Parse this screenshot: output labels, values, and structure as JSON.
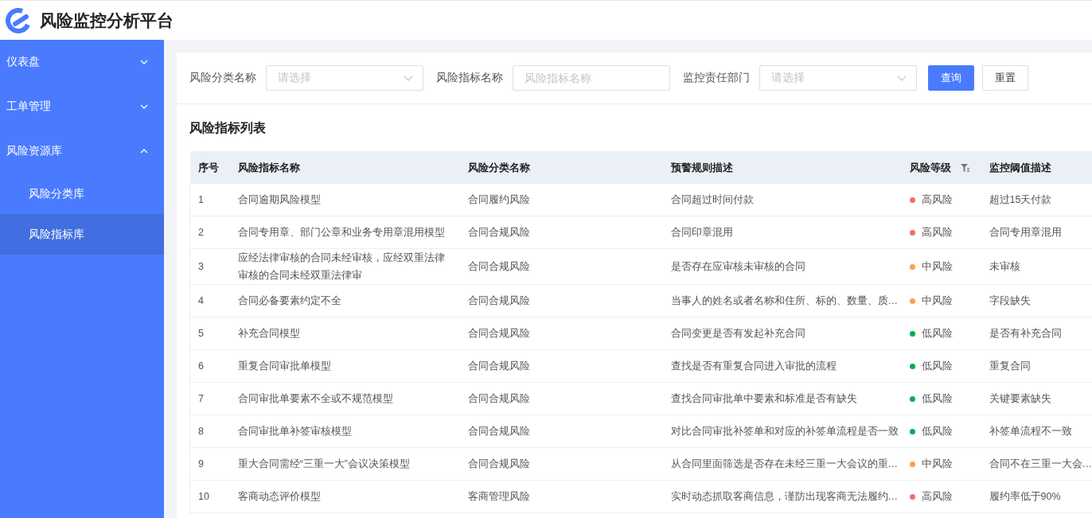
{
  "app": {
    "title": "风险监控分析平台"
  },
  "sidebar": {
    "items": [
      {
        "label": "仪表盘",
        "expanded": false
      },
      {
        "label": "工单管理",
        "expanded": false
      },
      {
        "label": "风险资源库",
        "expanded": true,
        "children": [
          {
            "label": "风险分类库",
            "selected": false
          },
          {
            "label": "风险指标库",
            "selected": true
          }
        ]
      }
    ]
  },
  "filters": [
    {
      "kind": "select",
      "label": "风险分类名称",
      "placeholder": "请选择"
    },
    {
      "kind": "input",
      "label": "风险指标名称",
      "placeholder": "风险指标名称"
    },
    {
      "kind": "select",
      "label": "监控责任部门",
      "placeholder": "请选择"
    }
  ],
  "buttons": [
    {
      "label": "查询",
      "kind": "primary"
    },
    {
      "label": "重置",
      "kind": "default"
    }
  ],
  "table": {
    "title": "风险指标列表",
    "columns": [
      {
        "label": "序号",
        "filter": false
      },
      {
        "label": "风险指标名称",
        "filter": false
      },
      {
        "label": "风险分类名称",
        "filter": false
      },
      {
        "label": "预警规则描述",
        "filter": false
      },
      {
        "label": "风险等级",
        "filter": true
      },
      {
        "label": "监控阈值描述",
        "filter": false
      }
    ],
    "rows": [
      {
        "no": "1",
        "name": "合同逾期风险模型",
        "category": "合同履约风险",
        "rule": "合同超过时间付款",
        "level": "高风险",
        "color": "#f56c6c",
        "threshold": "超过15天付款"
      },
      {
        "no": "2",
        "name": "合同专用章、部门公章和业务专用章混用模型",
        "category": "合同合规风险",
        "rule": "合同印章混用",
        "level": "高风险",
        "color": "#f56c6c",
        "threshold": "合同专用章混用"
      },
      {
        "no": "3",
        "name": "应经法律审核的合同未经审核，应经双重法律审核的合同未经双重法律审",
        "category": "合同合规风险",
        "rule": "是否存在应审核未审核的合同",
        "level": "中风险",
        "color": "#ff9f43",
        "threshold": "未审核"
      },
      {
        "no": "4",
        "name": "合同必备要素约定不全",
        "category": "合同合规风险",
        "rule": "当事人的姓名或者名称和住所、标的、数量、质…",
        "level": "中风险",
        "color": "#ff9f43",
        "threshold": "字段缺失"
      },
      {
        "no": "5",
        "name": "补充合同模型",
        "category": "合同合规风险",
        "rule": "合同变更是否有发起补充合同",
        "level": "低风险",
        "color": "#00b050",
        "threshold": "是否有补充合同"
      },
      {
        "no": "6",
        "name": "重复合同审批单模型",
        "category": "合同合规风险",
        "rule": "查找是否有重复合同进入审批的流程",
        "level": "低风险",
        "color": "#00b050",
        "threshold": "重复合同"
      },
      {
        "no": "7",
        "name": "合同审批单要素不全或不规范模型",
        "category": "合同合规风险",
        "rule": "查找合同审批单中要素和标准是否有缺失",
        "level": "低风险",
        "color": "#00b050",
        "threshold": "关键要素缺失"
      },
      {
        "no": "8",
        "name": "合同审批单补签审核模型",
        "category": "合同合规风险",
        "rule": "对比合同审批补签单和对应的补签单流程是否一致",
        "level": "低风险",
        "color": "#00b050",
        "threshold": "补签单流程不一致"
      },
      {
        "no": "9",
        "name": "重大合同需经“三重一大”会议决策模型",
        "category": "合同合规风险",
        "rule": "从合同里面筛选是否存在未经三重一大会议的重…",
        "level": "中风险",
        "color": "#ff9f43",
        "threshold": "合同不在三重一大会…"
      },
      {
        "no": "10",
        "name": "客商动态评价模型",
        "category": "客商管理风险",
        "rule": "实时动态抓取客商信息，谨防出现客商无法履约…",
        "level": "高风险",
        "color": "#f56c6c",
        "threshold": "履约率低于90%"
      }
    ]
  }
}
